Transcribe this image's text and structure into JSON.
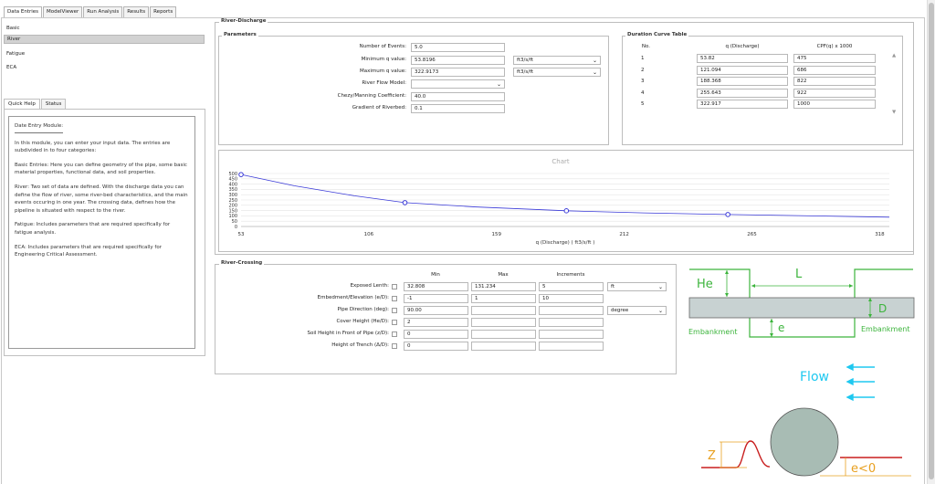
{
  "tabs": [
    "Data Entries",
    "ModelViewer",
    "Run Analysis",
    "Results",
    "Reports"
  ],
  "sidebar": {
    "items": [
      "Basic",
      "River",
      "Fatigue",
      "ECA"
    ],
    "selected": 1
  },
  "quick_help": {
    "tabs": [
      "Quick Help",
      "Status"
    ],
    "title": "Date Entry Module:",
    "paragraphs": [
      "In this module, you can enter your input data. The entries are subdivided in to four categories:",
      "Basic Entries:   Here you can define geometry of the pipe, some basic material properties, functional data, and soil properties.",
      "River: Two set of data are defined. With the discharge data you can define the flow of river, some river-bed characteristics, and the main events occuring in one year. The crossing data, defines how the pipeline is situated with respect to the river.",
      "Fatigue: Includes parameters that are required specifically for fatigue analysis.",
      "ECA: Includes parameters that are required specifically for Engineering Critical Assessment."
    ]
  },
  "river_discharge": {
    "title": "River-Discharge",
    "parameters": {
      "title": "Parameters",
      "events_label": "Number of Events:",
      "events_value": "5.0",
      "min_q_label": "Minimum q value:",
      "min_q_value": "53.8196",
      "min_q_unit": "ft3/s/ft",
      "max_q_label": "Maximum q value:",
      "max_q_value": "322.9173",
      "max_q_unit": "ft3/s/ft",
      "flow_model_label": "River Flow Model:",
      "flow_model_value": "",
      "chezy_label": "Chezy/Manning Coefficient:",
      "chezy_value": "40.0",
      "gradient_label": "Gradient of Riverbed:",
      "gradient_value": "0.1"
    },
    "duration_table": {
      "title": "Duration Curve Table",
      "headers": [
        "No.",
        "q (Discharge)",
        "CPF(q) x 1000"
      ],
      "rows": [
        [
          "1",
          "53.82",
          "475"
        ],
        [
          "2",
          "121.094",
          "686"
        ],
        [
          "3",
          "188.368",
          "822"
        ],
        [
          "4",
          "255.643",
          "922"
        ],
        [
          "5",
          "322.917",
          "1000"
        ]
      ]
    }
  },
  "chart_data": {
    "type": "line",
    "title": "Chart",
    "xlabel": "q (Discharge) ( ft3/s/ft )",
    "ylabel": "",
    "x_ticks": [
      53,
      106,
      159,
      212,
      265,
      318
    ],
    "y_ticks": [
      0,
      50,
      100,
      150,
      200,
      250,
      300,
      350,
      400,
      450,
      500
    ],
    "xlim": [
      53,
      322
    ],
    "ylim": [
      0,
      500
    ],
    "series": [
      {
        "values": [
          [
            53,
            490
          ],
          [
            75,
            385
          ],
          [
            100,
            290
          ],
          [
            121,
            225
          ],
          [
            150,
            185
          ],
          [
            188,
            148
          ],
          [
            220,
            128
          ],
          [
            255,
            113
          ],
          [
            290,
            100
          ],
          [
            322,
            88
          ]
        ],
        "markers": [
          [
            53,
            490
          ],
          [
            121,
            225
          ],
          [
            188,
            148
          ],
          [
            255,
            113
          ]
        ]
      }
    ],
    "grid": true,
    "color": "#3a3ad8"
  },
  "river_crossing": {
    "title": "River-Crossing",
    "headers": [
      "Min",
      "Max",
      "Increments"
    ],
    "rows": [
      {
        "label": "Exposed Lenth:",
        "min": "32.808",
        "max": "131.234",
        "inc": "5",
        "unit": "ft",
        "has_unit": true
      },
      {
        "label": "Embedment/Elevation (e/D):",
        "min": "-1",
        "max": "1",
        "inc": "10",
        "unit": "",
        "has_unit": false
      },
      {
        "label": "Pipe Direction (deg):",
        "min": "90.00",
        "max": "",
        "inc": "",
        "unit": "degree",
        "has_unit": true
      },
      {
        "label": "Cover Height (He/D):",
        "min": "2",
        "max": "",
        "inc": "",
        "unit": "",
        "has_unit": false
      },
      {
        "label": "Soil Height in Front of Pipe (z/D):",
        "min": "0",
        "max": "",
        "inc": "",
        "unit": "",
        "has_unit": false
      },
      {
        "label": "Height of Trench (Δ/D):",
        "min": "0",
        "max": "",
        "inc": "",
        "unit": "",
        "has_unit": false
      }
    ]
  },
  "diagram": {
    "he": "He",
    "l": "L",
    "d": "D",
    "e": "e",
    "embankment_left": "Embankment",
    "embankment_right": "Embankment",
    "flow": "Flow",
    "z": "Z",
    "e_lt_0": "e<0",
    "green": "#3cb43c",
    "cyan": "#1ec8f0",
    "red": "#c81e1e",
    "orange": "#e8a020"
  }
}
